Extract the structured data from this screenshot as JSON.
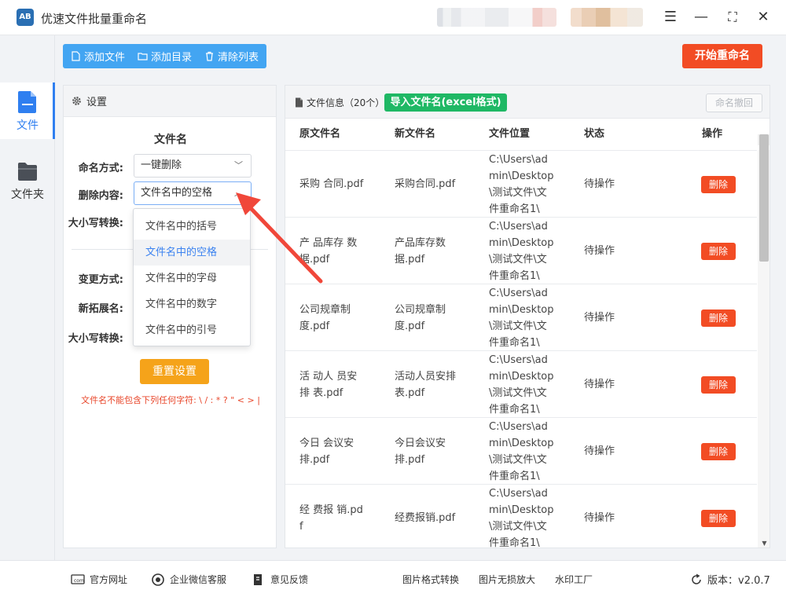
{
  "app": {
    "title": "优速文件批量重命名",
    "logo_text": "AB"
  },
  "window_controls": {
    "menu": "☰",
    "minimize": "—",
    "maximize": "⛶",
    "close": "✕"
  },
  "nav": [
    {
      "label": "文件",
      "icon": "file-icon",
      "active": true
    },
    {
      "label": "文件夹",
      "icon": "folder-icon",
      "active": false
    }
  ],
  "toolbar": {
    "add_file": "添加文件",
    "add_dir": "添加目录",
    "clear_list": "清除列表",
    "start": "开始重命名"
  },
  "settings": {
    "header": "设置",
    "section_title": "文件名",
    "naming_mode_label": "命名方式:",
    "naming_mode_value": "一键删除",
    "delete_content_label": "删除内容:",
    "delete_content_value": "文件名中的空格",
    "case_label_1": "大小写转换:",
    "change_mode_label": "变更方式:",
    "new_ext_label": "新拓展名:",
    "case_label_2": "大小写转换:",
    "reset_button": "重置设置",
    "warning": "文件名不能包含下列任何字符: \\ / : * ? \" < > |",
    "dropdown_options": [
      "文件名中的括号",
      "文件名中的空格",
      "文件名中的字母",
      "文件名中的数字",
      "文件名中的引号"
    ],
    "dropdown_selected_index": 1
  },
  "files": {
    "header_title": "文件信息（20个）",
    "import_button": "导入文件名(excel格式)",
    "undo_button": "命名撤回",
    "columns": [
      "原文件名",
      "新文件名",
      "文件位置",
      "状态",
      "操作"
    ],
    "rows": [
      {
        "orig": [
          "采购 合同.pdf"
        ],
        "new": [
          "采购合同.pdf"
        ],
        "loc": [
          "C:\\Users\\ad",
          "min\\Desktop",
          "\\测试文件\\文",
          "件重命名1\\"
        ],
        "status": "待操作",
        "action": "删除"
      },
      {
        "orig": [
          "产 品库存 数",
          "据.pdf"
        ],
        "new": [
          "产品库存数",
          "据.pdf"
        ],
        "loc": [
          "C:\\Users\\ad",
          "min\\Desktop",
          "\\测试文件\\文",
          "件重命名1\\"
        ],
        "status": "待操作",
        "action": "删除"
      },
      {
        "orig": [
          "公司规章制",
          "度.pdf"
        ],
        "new": [
          "公司规章制",
          "度.pdf"
        ],
        "loc": [
          "C:\\Users\\ad",
          "min\\Desktop",
          "\\测试文件\\文",
          "件重命名1\\"
        ],
        "status": "待操作",
        "action": "删除"
      },
      {
        "orig": [
          "活 动人 员安",
          "排 表.pdf"
        ],
        "new": [
          "活动人员安排",
          "表.pdf"
        ],
        "loc": [
          "C:\\Users\\ad",
          "min\\Desktop",
          "\\测试文件\\文",
          "件重命名1\\"
        ],
        "status": "待操作",
        "action": "删除"
      },
      {
        "orig": [
          "今日 会议安",
          "排.pdf"
        ],
        "new": [
          "今日会议安",
          "排.pdf"
        ],
        "loc": [
          "C:\\Users\\ad",
          "min\\Desktop",
          "\\测试文件\\文",
          "件重命名1\\"
        ],
        "status": "待操作",
        "action": "删除"
      },
      {
        "orig": [
          "经 费报 销.pd",
          "f"
        ],
        "new": [
          "经费报销.pdf"
        ],
        "loc": [
          "C:\\Users\\ad",
          "min\\Desktop",
          "\\测试文件\\文",
          "件重命名1\\"
        ],
        "status": "待操作",
        "action": "删除"
      }
    ]
  },
  "footer": {
    "website": "官方网址",
    "wechat": "企业微信客服",
    "feedback": "意见反馈",
    "format_convert": "图片格式转换",
    "lossless_zoom": "图片无损放大",
    "watermark": "水印工厂",
    "version": "版本：v2.0.7"
  },
  "colors": {
    "accent_blue": "#43a5f2",
    "start_red": "#f24c24",
    "import_green": "#1fb865",
    "reset_orange": "#f5a31a"
  }
}
